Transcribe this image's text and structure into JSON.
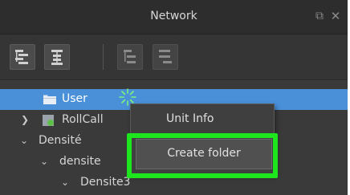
{
  "window": {
    "title": "Network"
  },
  "toolbar": {
    "buttons": [
      {
        "icon": "expand-tree-icon"
      },
      {
        "icon": "collapse-tree-icon"
      },
      {
        "icon": "tree-view-icon"
      },
      {
        "icon": "list-view-icon"
      }
    ]
  },
  "tree": {
    "items": [
      {
        "label": "User",
        "icon": "folder-icon"
      },
      {
        "label": "RollCall",
        "icon": "device-icon"
      },
      {
        "label": "Densité"
      },
      {
        "label": "densite"
      },
      {
        "label": "Densite3"
      }
    ]
  },
  "context_menu": {
    "items": [
      {
        "label": "Unit Info"
      },
      {
        "label": "Create folder"
      }
    ]
  },
  "colors": {
    "selection": "#4a90d9",
    "highlight": "#1ee61e",
    "panel": "#3a3a3a"
  }
}
